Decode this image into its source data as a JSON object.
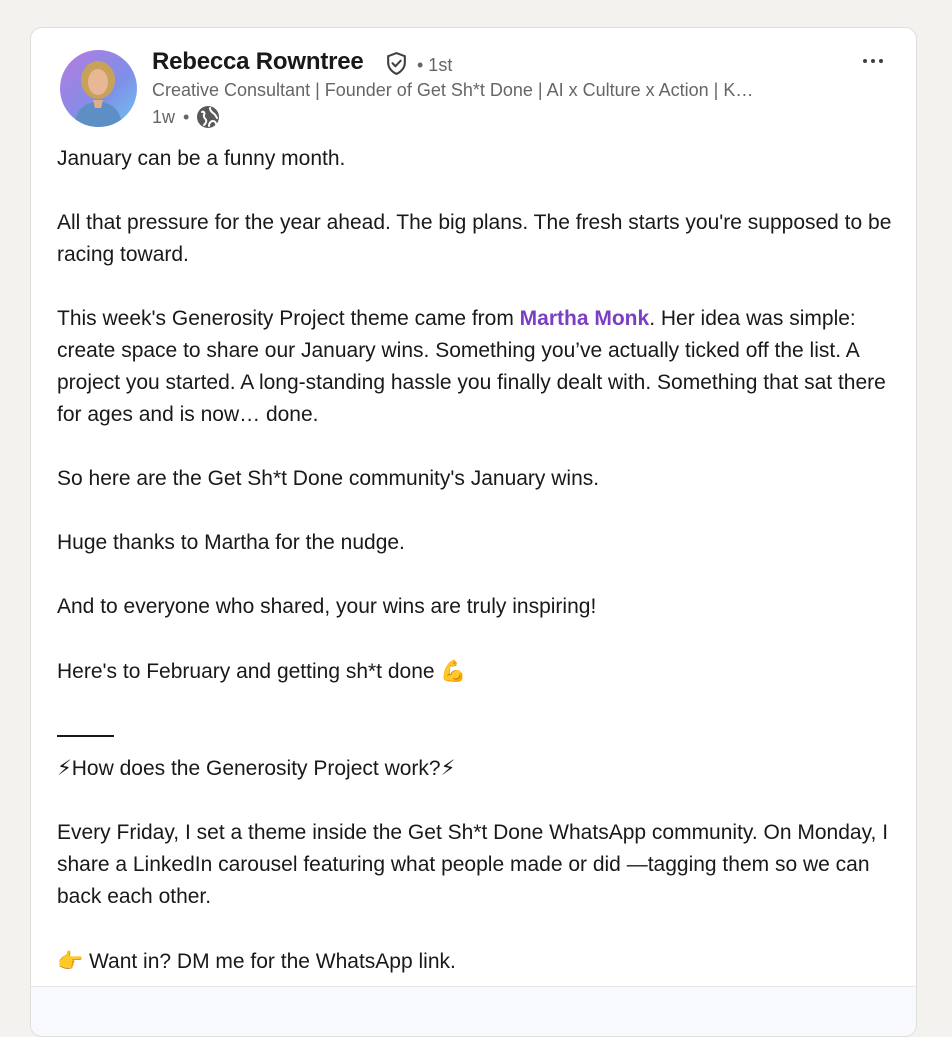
{
  "post": {
    "author": {
      "name": "Rebecca Rowntree",
      "connection_degree": "• 1st",
      "headline": "Creative Consultant | Founder of Get Sh*t Done | AI x Culture x Action | K…",
      "posted_ago": "1w",
      "meta_separator": "•",
      "visibility_icon": "globe-icon",
      "verified_icon": "verified-shield-icon"
    },
    "more_options_icon": "more-horizontal-icon",
    "body": {
      "p1": "January can be a funny month.",
      "p2": "All that pressure for the year ahead. The big plans. The fresh starts you're supposed to be racing toward.",
      "p3_before": "This week's Generosity Project theme came from ",
      "p3_mention": "Martha Monk",
      "p3_after": ". Her idea was simple: create space to share our January wins. Something you’ve actually ticked off the list. A project you started. A long-standing hassle you finally dealt with. Something that sat there for ages and is now… done.",
      "p4": "So here are the Get Sh*t Done community's January wins.",
      "p5": "Huge thanks to Martha for the nudge.",
      "p6": "And to everyone who shared, your wins are truly inspiring!",
      "p7": "Here's to February and getting sh*t done",
      "p7_emoji": "💪",
      "how_heading": "How does the Generosity Project work?",
      "how_emoji": "⚡",
      "p8": "Every Friday, I set a theme inside the Get Sh*t Done WhatsApp community. On Monday, I share a LinkedIn carousel featuring what people made or did —tagging them so we can back each other.",
      "cta_emoji": "👉",
      "p9": " Want in? DM me for the WhatsApp link."
    }
  },
  "colors": {
    "background": "#f4f2ee",
    "card": "#ffffff",
    "mention": "#7b3fc4",
    "text_primary": "#191919",
    "text_secondary": "#666666"
  }
}
